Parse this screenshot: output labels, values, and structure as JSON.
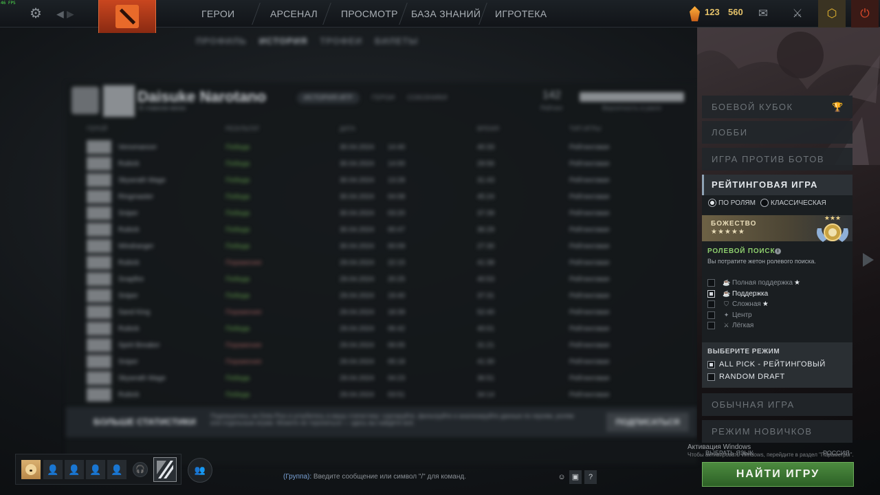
{
  "fps": "46 FPS",
  "nav": {
    "menu": [
      "ГЕРОИ",
      "АРСЕНАЛ",
      "ПРОСМОТР",
      "БАЗА ЗНАНИЙ",
      "ИГРОТЕКА"
    ]
  },
  "currency": {
    "shards": "123",
    "gold": "560"
  },
  "icons": {
    "settings": "gear-icon",
    "back": "arrow-left-icon",
    "forward": "arrow-right-icon",
    "mail": "mail-icon",
    "armory": "sword-icon",
    "plus": "dota-plus-icon",
    "power": "power-icon"
  },
  "profile": {
    "subtabs": [
      "ПРОФИЛЬ",
      "ИСТОРИЯ",
      "ТРОФЕИ",
      "БИЛЕТЫ"
    ],
    "name": "Daisuke Narotano",
    "subtitle": "В главном меню",
    "tabs": [
      "ИСТОРИЯ ИГР",
      "ГЕРОИ",
      "СОЮЗНИКИ"
    ],
    "stat_value": "142",
    "stat_label": "Рейтинг",
    "bar_label": "Вероятность в ранге",
    "columns": [
      "ГЕРОЙ",
      "РЕЗУЛЬТАТ",
      "ДАТА",
      "ВРЕМЯ",
      "ТИП ИГРЫ"
    ],
    "rows": [
      {
        "hero": "Venomancer",
        "result": "Победа",
        "date": "30.04.2024",
        "time": "14:40",
        "duration": "40:33",
        "type": "Рейтинговая"
      },
      {
        "hero": "Rubick",
        "result": "Победа",
        "date": "30.04.2024",
        "time": "14:00",
        "duration": "29:56",
        "type": "Рейтинговая"
      },
      {
        "hero": "Skywrath Mage",
        "result": "Победа",
        "date": "30.04.2024",
        "time": "13:28",
        "duration": "31:43",
        "type": "Рейтинговая"
      },
      {
        "hero": "Ringmaster",
        "result": "Победа",
        "date": "30.04.2024",
        "time": "04:08",
        "duration": "45:24",
        "type": "Рейтинговая"
      },
      {
        "hero": "Sniper",
        "result": "Победа",
        "date": "30.04.2024",
        "time": "03:20",
        "duration": "37:39",
        "type": "Рейтинговая"
      },
      {
        "hero": "Rubick",
        "result": "Победа",
        "date": "30.04.2024",
        "time": "00:47",
        "duration": "36:29",
        "type": "Рейтинговая"
      },
      {
        "hero": "Windranger",
        "result": "Победа",
        "date": "30.04.2024",
        "time": "00:09",
        "duration": "27:30",
        "type": "Рейтинговая"
      },
      {
        "hero": "Rubick",
        "result": "Поражение",
        "date": "29.04.2024",
        "time": "22:15",
        "duration": "41:38",
        "type": "Рейтинговая"
      },
      {
        "hero": "Snapfire",
        "result": "Победа",
        "date": "29.04.2024",
        "time": "20:25",
        "duration": "40:53",
        "type": "Рейтинговая"
      },
      {
        "hero": "Sniper",
        "result": "Победа",
        "date": "29.04.2024",
        "time": "19:40",
        "duration": "37:31",
        "type": "Рейтинговая"
      },
      {
        "hero": "Sand King",
        "result": "Поражение",
        "date": "29.04.2024",
        "time": "18:39",
        "duration": "52:40",
        "type": "Рейтинговая"
      },
      {
        "hero": "Rubick",
        "result": "Победа",
        "date": "29.04.2024",
        "time": "06:42",
        "duration": "40:01",
        "type": "Рейтинговая"
      },
      {
        "hero": "Spirit Breaker",
        "result": "Поражение",
        "date": "29.04.2024",
        "time": "06:05",
        "duration": "31:21",
        "type": "Рейтинговая"
      },
      {
        "hero": "Sniper",
        "result": "Поражение",
        "date": "29.04.2024",
        "time": "05:18",
        "duration": "41:30",
        "type": "Рейтинговая"
      },
      {
        "hero": "Skywrath Mage",
        "result": "Победа",
        "date": "29.04.2024",
        "time": "04:23",
        "duration": "36:51",
        "type": "Рейтинговая"
      },
      {
        "hero": "Rubick",
        "result": "Победа",
        "date": "29.04.2024",
        "time": "03:51",
        "duration": "34:14",
        "type": "Рейтинговая"
      }
    ],
    "banner_title": "БОЛЬШЕ СТАТИСТИКИ",
    "banner_text": "Подпишитесь на Dota Plus и углубитесь в вашу статистику: сортируйте, фильтруйте и анализируйте данные по героям, ролям или отдельным играм. Можете не торопиться — здесь вы найдёте всё.",
    "banner_button": "ПОДПИСАТЬСЯ"
  },
  "play": {
    "battle_cup": "БОЕВОЙ КУБОК",
    "lobby": "ЛОББИ",
    "bots": "ИГРА ПРОТИВ БОТОВ",
    "ranked": "РЕЙТИНГОВАЯ ИГРА",
    "queue_roles": "ПО РОЛЯМ",
    "queue_classic": "КЛАССИЧЕСКАЯ",
    "rank_name": "БОЖЕСТВО",
    "rank_stars": "★★★★★",
    "role_search_title": "РОЛЕВОЙ ПОИСК",
    "role_search_desc": "Вы потратите жетон ролевого поиска.",
    "roles": [
      {
        "label": "Полная поддержка",
        "star": "★",
        "checked": false
      },
      {
        "label": "Поддержка",
        "star": "",
        "checked": true
      },
      {
        "label": "Сложная",
        "star": "★",
        "checked": false
      },
      {
        "label": "Центр",
        "star": "",
        "checked": false
      },
      {
        "label": "Лёгкая",
        "star": "",
        "checked": false
      }
    ],
    "mode_title": "ВЫБЕРИТЕ РЕЖИМ",
    "modes": [
      {
        "label": "ALL PICK - РЕЙТИНГОВЫЙ",
        "checked": true
      },
      {
        "label": "RANDOM DRAFT",
        "checked": false
      }
    ],
    "normal": "ОБЫЧНАЯ ИГРА",
    "newbie": "РЕЖИМ НОВИЧКОВ",
    "language_label": "ВЫБРАТЬ ЯЗЫК",
    "language_value": "РОССИЯ",
    "find": "НАЙТИ ИГРУ"
  },
  "windows": {
    "line1": "Активация Windows",
    "line2": "Чтобы активировать Windows, перейдите в раздел \"Параметры\"."
  },
  "chat": {
    "channel": "(Группа):",
    "placeholder": "Введите сообщение или символ \"/\" для команд.",
    "help": "?"
  },
  "colors": {
    "accent_green": "#4c8a3f",
    "role_green": "#8fd06e",
    "divine_gold": "#e8dcb8",
    "dota_red": "#c9461f"
  }
}
